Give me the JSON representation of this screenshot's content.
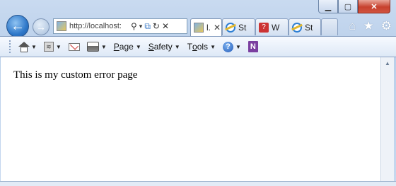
{
  "window": {
    "controls": {
      "minimize": "▁",
      "maximize": "▢",
      "close": "✕"
    }
  },
  "nav": {
    "back_icon": "←",
    "forward_icon": "→",
    "address": {
      "url": "http://localhost:",
      "search_icon": "⚲",
      "dropdown_icon": "▾",
      "compat_icon": "⧉",
      "refresh_icon": "↻",
      "stop_icon": "✕"
    }
  },
  "tabs": [
    {
      "label": "l.",
      "icon": "page-icon",
      "active": true,
      "close": "✕"
    },
    {
      "label": "St",
      "icon": "ie-icon",
      "active": false
    },
    {
      "label": "W",
      "icon": "question-icon",
      "active": false
    },
    {
      "label": "St",
      "icon": "ie-icon",
      "active": false
    }
  ],
  "right_icons": {
    "home": "⌂",
    "favorites": "★",
    "tools": "⚙"
  },
  "commandbar": {
    "page": {
      "underlined": "P",
      "rest": "age"
    },
    "safety": {
      "underlined": "S",
      "rest": "afety"
    },
    "tools": {
      "prefix": "T",
      "underlined": "o",
      "rest": "ols"
    },
    "help_icon": "?",
    "onenote_icon": "N",
    "arrow": "▼"
  },
  "content": {
    "message": "This is my custom error page"
  },
  "colors": {
    "chrome": "#c9daf0",
    "close": "#c7412e",
    "accent": "#2f78c9"
  }
}
